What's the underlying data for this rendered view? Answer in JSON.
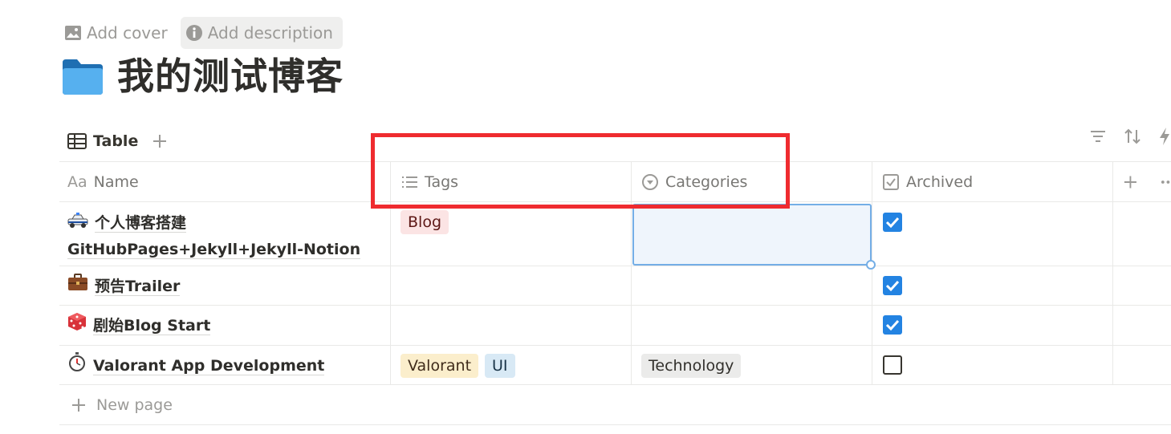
{
  "topbar": {
    "add_cover": "Add cover",
    "add_description": "Add description"
  },
  "page": {
    "title": "我的测试博客",
    "icon": "folder-icon"
  },
  "view": {
    "tab_label": "Table"
  },
  "columns": {
    "name": "Name",
    "name_prefix": "Aa",
    "tags": "Tags",
    "categories": "Categories",
    "archived": "Archived"
  },
  "rows": [
    {
      "name_line1": "个人博客搭建",
      "name_line2": "GitHubPages+Jekyll+Jekyll-Notion",
      "icon": "police-car-icon",
      "tags": [
        "Blog"
      ],
      "category": "",
      "archived": true
    },
    {
      "name": "预告Trailer",
      "icon": "briefcase-icon",
      "tags": [],
      "category": "",
      "archived": true
    },
    {
      "name": "剧始Blog Start",
      "icon": "dice-icon",
      "tags": [],
      "category": "",
      "archived": true
    },
    {
      "name": "Valorant App Development",
      "icon": "stopwatch-icon",
      "tags": [
        "Valorant",
        "UI"
      ],
      "category": "Technology",
      "archived": false
    }
  ],
  "new_page": "New page",
  "colors": {
    "accent": "#2383e2",
    "highlight_box": "#ef2b2f",
    "selection": "#74aee6"
  }
}
